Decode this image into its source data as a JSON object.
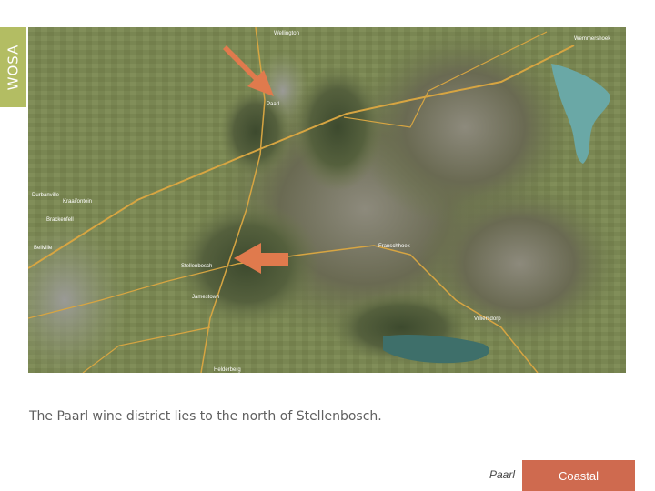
{
  "sidebar": {
    "brand": "WOSA"
  },
  "map": {
    "place_labels": [
      "Wellington",
      "Paarl",
      "Durbanville",
      "Bellville",
      "Stellenbosch",
      "Franschhoek",
      "Villiersdorp",
      "Wemmershoek",
      "Kraaifontein",
      "Brackenfell",
      "Jamestown",
      "Helderberg"
    ],
    "arrow_color": "#e07a4d"
  },
  "caption": "The Paarl wine district lies to the north of Stellenbosch.",
  "footer": {
    "region_label": "Paarl",
    "button_label": "Coastal",
    "button_color": "#cf6a4f"
  }
}
